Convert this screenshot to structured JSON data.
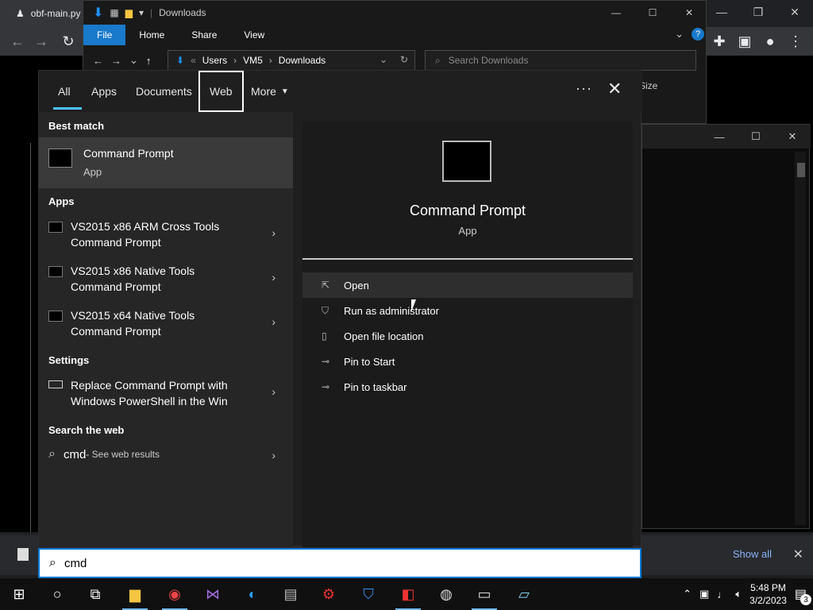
{
  "browser": {
    "tab_title": "obf-main.py"
  },
  "explorer": {
    "title": "Downloads",
    "ribbon": [
      "File",
      "Home",
      "Share",
      "View"
    ],
    "breadcrumb": [
      "Users",
      "VM5",
      "Downloads"
    ],
    "search_placeholder": "Search Downloads",
    "column_size": "Size"
  },
  "search": {
    "tabs": {
      "all": "All",
      "apps": "Apps",
      "documents": "Documents",
      "web": "Web",
      "more": "More"
    },
    "sections": {
      "best_match": "Best match",
      "apps": "Apps",
      "settings": "Settings",
      "web": "Search the web"
    },
    "best_match": {
      "name": "Command Prompt",
      "type": "App"
    },
    "apps": [
      {
        "line1": "VS2015 x86 ARM Cross Tools",
        "line2": "Command Prompt"
      },
      {
        "line1": "VS2015 x86 Native Tools",
        "line2": "Command Prompt"
      },
      {
        "line1": "VS2015 x64 Native Tools",
        "line2": "Command Prompt"
      }
    ],
    "settings": [
      {
        "line1": "Replace Command Prompt with",
        "line2": "Windows PowerShell in the Win"
      }
    ],
    "web": {
      "query": "cmd",
      "suffix": " - See web results"
    },
    "detail": {
      "name": "Command Prompt",
      "type": "App",
      "actions": [
        "Open",
        "Run as administrator",
        "Open file location",
        "Pin to Start",
        "Pin to taskbar"
      ]
    },
    "input_value": "cmd"
  },
  "downloads_bar": {
    "show_all": "Show all"
  },
  "taskbar": {
    "time": "5:48 PM",
    "date": "3/2/2023",
    "notification_count": "3"
  }
}
